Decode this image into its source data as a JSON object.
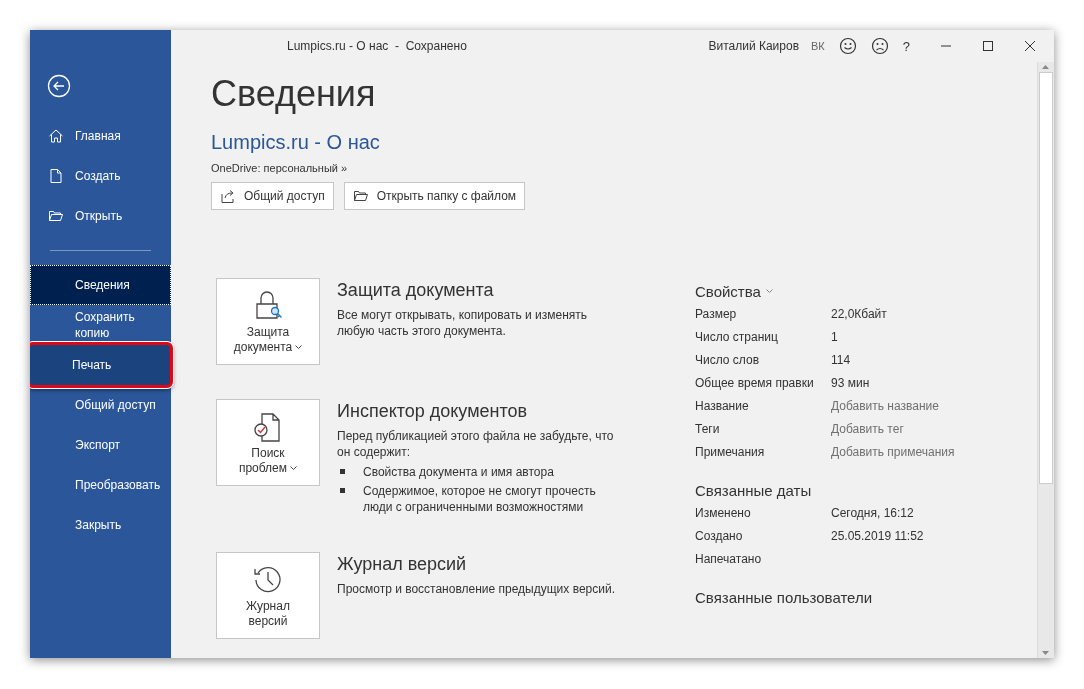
{
  "titlebar": {
    "title": "Lumpics.ru - О нас  -  Сохранено",
    "user": "Виталий Каиров",
    "user_badge": "ВК",
    "help": "?"
  },
  "sidebar": {
    "items": [
      {
        "label": "Главная",
        "kind": "icon",
        "selected": false,
        "highlighted": false
      },
      {
        "label": "Создать",
        "kind": "icon",
        "selected": false,
        "highlighted": false
      },
      {
        "label": "Открыть",
        "kind": "icon",
        "selected": false,
        "highlighted": false
      },
      {
        "label": "Сведения",
        "kind": "plain",
        "selected": true,
        "highlighted": false
      },
      {
        "label": "Сохранить копию",
        "kind": "plain",
        "selected": false,
        "highlighted": false
      },
      {
        "label": "Печать",
        "kind": "plain",
        "selected": false,
        "highlighted": true
      },
      {
        "label": "Общий доступ",
        "kind": "plain",
        "selected": false,
        "highlighted": false
      },
      {
        "label": "Экспорт",
        "kind": "plain",
        "selected": false,
        "highlighted": false
      },
      {
        "label": "Преобразовать",
        "kind": "plain",
        "selected": false,
        "highlighted": false
      },
      {
        "label": "Закрыть",
        "kind": "plain",
        "selected": false,
        "highlighted": false
      }
    ]
  },
  "page": {
    "title": "Сведения",
    "doc_name": "Lumpics.ru - О нас",
    "location": "OneDrive: персональный »",
    "actions": [
      {
        "label": "Общий доступ"
      },
      {
        "label": "Открыть папку с файлом"
      }
    ]
  },
  "sections": [
    {
      "tile_label": "Защита документа",
      "dropdown": true,
      "heading": "Защита документа",
      "text": "Все могут открывать, копировать и изменять любую часть этого документа."
    },
    {
      "tile_label": "Поиск проблем",
      "dropdown": true,
      "heading": "Инспектор документов",
      "text": "Перед публикацией этого файла не забудьте, что он содержит:",
      "bullets": [
        "Свойства документа и имя автора",
        "Содержимое, которое не смогут прочесть люди с ограниченными возможностями"
      ]
    },
    {
      "tile_label": "Журнал версий",
      "dropdown": false,
      "heading": "Журнал версий",
      "text": "Просмотр и восстановление предыдущих версий."
    }
  ],
  "properties": {
    "heading": "Свойства",
    "rows": [
      {
        "label": "Размер",
        "value": "22,0Кбайт"
      },
      {
        "label": "Число страниц",
        "value": "1"
      },
      {
        "label": "Число слов",
        "value": "114"
      },
      {
        "label": "Общее время правки",
        "value": "93 мин"
      },
      {
        "label": "Название",
        "placeholder": "Добавить название"
      },
      {
        "label": "Теги",
        "placeholder": "Добавить тег"
      },
      {
        "label": "Примечания",
        "placeholder": "Добавить примечания"
      }
    ]
  },
  "dates": {
    "heading": "Связанные даты",
    "rows": [
      {
        "label": "Изменено",
        "value": "Сегодня, 16:12"
      },
      {
        "label": "Создано",
        "value": "25.05.2019 11:52"
      },
      {
        "label": "Напечатано"
      }
    ]
  },
  "people": {
    "heading": "Связанные пользователи"
  }
}
